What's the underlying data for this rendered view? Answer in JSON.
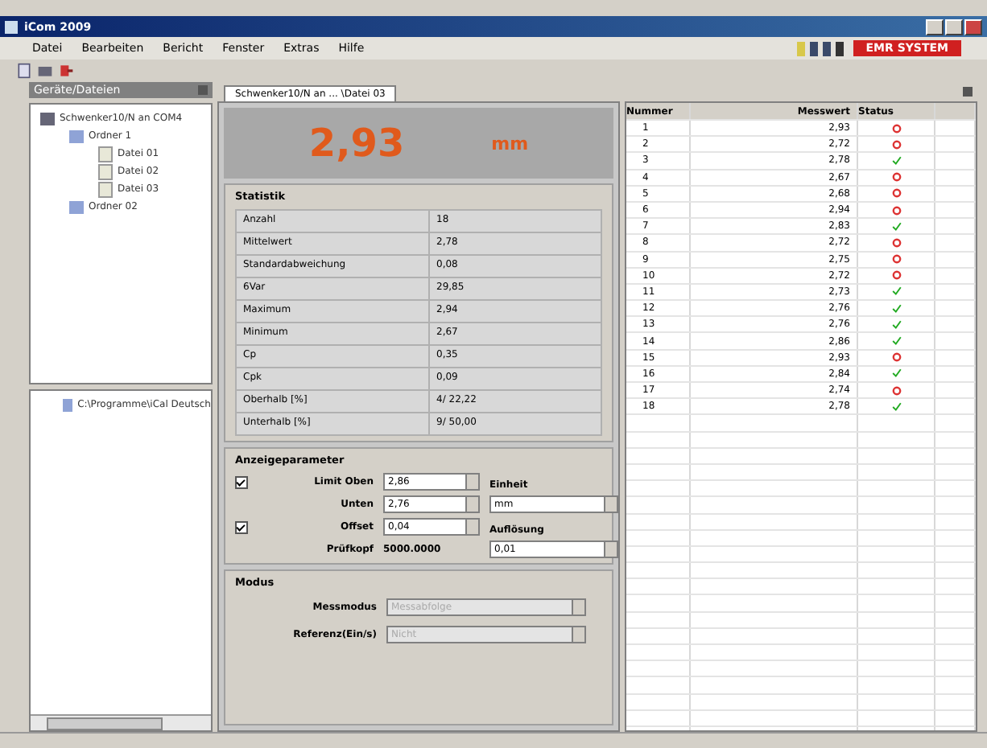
{
  "window": {
    "title": "iCom 2009",
    "badge": "EMR SYSTEM"
  },
  "menu": [
    "Datei",
    "Bearbeiten",
    "Bericht",
    "Fenster",
    "Extras",
    "Hilfe"
  ],
  "sidebar": {
    "title": "Geräte/Dateien",
    "tree": [
      {
        "label": "Schwenker10/N an COM4",
        "kind": "device",
        "children": [
          {
            "label": "Ordner 1",
            "kind": "folder",
            "children": [
              {
                "label": "Datei 01",
                "kind": "file"
              },
              {
                "label": "Datei 02",
                "kind": "file"
              },
              {
                "label": "Datei 03",
                "kind": "file"
              }
            ]
          },
          {
            "label": "Ordner 02",
            "kind": "folder"
          }
        ]
      }
    ],
    "tree2": [
      {
        "label": "C:\\Programme\\iCal Deutsch",
        "kind": "folder"
      }
    ]
  },
  "tab": {
    "label": "Schwenker10/N an ... \\Datei 03",
    "selected": true
  },
  "display": {
    "value": "2,93",
    "unit": "mm"
  },
  "statistik": {
    "title": "Statistik",
    "rows": [
      [
        "Anzahl",
        "18"
      ],
      [
        "Mittelwert",
        "2,78"
      ],
      [
        "Standardabweichung",
        "0,08"
      ],
      [
        "6Var",
        "29,85"
      ],
      [
        "Maximum",
        "2,94"
      ],
      [
        "Minimum",
        "2,67"
      ],
      [
        "Cp",
        "0,35"
      ],
      [
        "Cpk",
        "0,09"
      ],
      [
        "Oberhalb [%]",
        "4/ 22,22"
      ],
      [
        "Unterhalb [%]",
        "9/ 50,00"
      ]
    ]
  },
  "anzeige": {
    "title": "Anzeigeparameter",
    "limit_oben": {
      "label": "Limit Oben",
      "value": "2,86",
      "checked": true
    },
    "unten": {
      "label": "Unten",
      "value": "2,76"
    },
    "offset": {
      "label": "Offset",
      "value": "0,04",
      "checked": true
    },
    "pruefkopf": {
      "label": "Prüfkopf",
      "value": "5000.0000"
    },
    "einheit": {
      "label": "Einheit",
      "value": "mm"
    },
    "aufloesung": {
      "label": "Auflösung",
      "value": "0,01"
    }
  },
  "modus": {
    "title": "Modus",
    "fields": [
      {
        "label": "Messmodus",
        "value": "Messabfolge",
        "disabled": true
      },
      {
        "label": "Referenz(Ein/s)",
        "value": "Nicht",
        "disabled": true
      }
    ]
  },
  "table": {
    "columns": [
      "Nummer",
      "Messwert",
      "Status"
    ],
    "rows": [
      {
        "n": "1",
        "v": "2,93",
        "ok": false
      },
      {
        "n": "2",
        "v": "2,72",
        "ok": false
      },
      {
        "n": "3",
        "v": "2,78",
        "ok": true
      },
      {
        "n": "4",
        "v": "2,67",
        "ok": false
      },
      {
        "n": "5",
        "v": "2,68",
        "ok": false
      },
      {
        "n": "6",
        "v": "2,94",
        "ok": false
      },
      {
        "n": "7",
        "v": "2,83",
        "ok": true
      },
      {
        "n": "8",
        "v": "2,72",
        "ok": false
      },
      {
        "n": "9",
        "v": "2,75",
        "ok": false
      },
      {
        "n": "10",
        "v": "2,72",
        "ok": false
      },
      {
        "n": "11",
        "v": "2,73",
        "ok": true
      },
      {
        "n": "12",
        "v": "2,76",
        "ok": true
      },
      {
        "n": "13",
        "v": "2,76",
        "ok": true
      },
      {
        "n": "14",
        "v": "2,86",
        "ok": true
      },
      {
        "n": "15",
        "v": "2,93",
        "ok": false
      },
      {
        "n": "16",
        "v": "2,84",
        "ok": true
      },
      {
        "n": "17",
        "v": "2,74",
        "ok": false
      },
      {
        "n": "18",
        "v": "2,78",
        "ok": true
      }
    ]
  }
}
